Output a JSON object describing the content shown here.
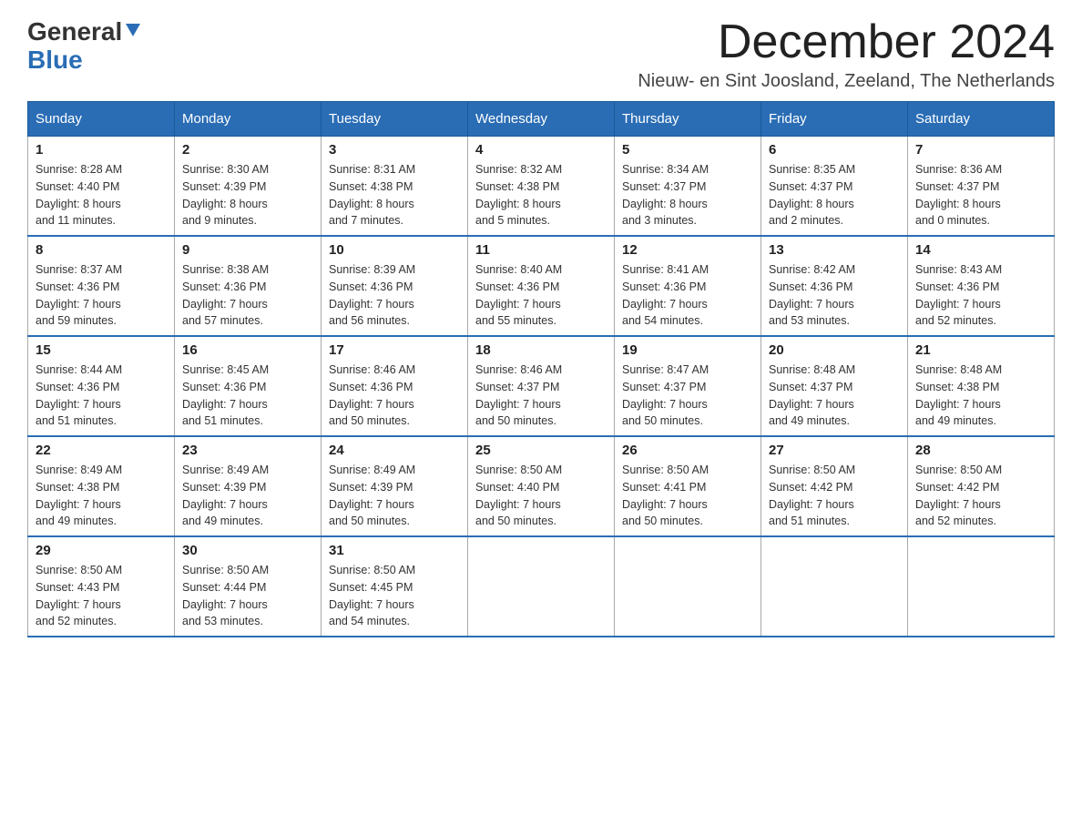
{
  "logo": {
    "text1": "General",
    "text2": "Blue"
  },
  "title": "December 2024",
  "location": "Nieuw- en Sint Joosland, Zeeland, The Netherlands",
  "headers": [
    "Sunday",
    "Monday",
    "Tuesday",
    "Wednesday",
    "Thursday",
    "Friday",
    "Saturday"
  ],
  "weeks": [
    [
      {
        "day": "1",
        "sunrise": "8:28 AM",
        "sunset": "4:40 PM",
        "daylight": "8 hours and 11 minutes."
      },
      {
        "day": "2",
        "sunrise": "8:30 AM",
        "sunset": "4:39 PM",
        "daylight": "8 hours and 9 minutes."
      },
      {
        "day": "3",
        "sunrise": "8:31 AM",
        "sunset": "4:38 PM",
        "daylight": "8 hours and 7 minutes."
      },
      {
        "day": "4",
        "sunrise": "8:32 AM",
        "sunset": "4:38 PM",
        "daylight": "8 hours and 5 minutes."
      },
      {
        "day": "5",
        "sunrise": "8:34 AM",
        "sunset": "4:37 PM",
        "daylight": "8 hours and 3 minutes."
      },
      {
        "day": "6",
        "sunrise": "8:35 AM",
        "sunset": "4:37 PM",
        "daylight": "8 hours and 2 minutes."
      },
      {
        "day": "7",
        "sunrise": "8:36 AM",
        "sunset": "4:37 PM",
        "daylight": "8 hours and 0 minutes."
      }
    ],
    [
      {
        "day": "8",
        "sunrise": "8:37 AM",
        "sunset": "4:36 PM",
        "daylight": "7 hours and 59 minutes."
      },
      {
        "day": "9",
        "sunrise": "8:38 AM",
        "sunset": "4:36 PM",
        "daylight": "7 hours and 57 minutes."
      },
      {
        "day": "10",
        "sunrise": "8:39 AM",
        "sunset": "4:36 PM",
        "daylight": "7 hours and 56 minutes."
      },
      {
        "day": "11",
        "sunrise": "8:40 AM",
        "sunset": "4:36 PM",
        "daylight": "7 hours and 55 minutes."
      },
      {
        "day": "12",
        "sunrise": "8:41 AM",
        "sunset": "4:36 PM",
        "daylight": "7 hours and 54 minutes."
      },
      {
        "day": "13",
        "sunrise": "8:42 AM",
        "sunset": "4:36 PM",
        "daylight": "7 hours and 53 minutes."
      },
      {
        "day": "14",
        "sunrise": "8:43 AM",
        "sunset": "4:36 PM",
        "daylight": "7 hours and 52 minutes."
      }
    ],
    [
      {
        "day": "15",
        "sunrise": "8:44 AM",
        "sunset": "4:36 PM",
        "daylight": "7 hours and 51 minutes."
      },
      {
        "day": "16",
        "sunrise": "8:45 AM",
        "sunset": "4:36 PM",
        "daylight": "7 hours and 51 minutes."
      },
      {
        "day": "17",
        "sunrise": "8:46 AM",
        "sunset": "4:36 PM",
        "daylight": "7 hours and 50 minutes."
      },
      {
        "day": "18",
        "sunrise": "8:46 AM",
        "sunset": "4:37 PM",
        "daylight": "7 hours and 50 minutes."
      },
      {
        "day": "19",
        "sunrise": "8:47 AM",
        "sunset": "4:37 PM",
        "daylight": "7 hours and 50 minutes."
      },
      {
        "day": "20",
        "sunrise": "8:48 AM",
        "sunset": "4:37 PM",
        "daylight": "7 hours and 49 minutes."
      },
      {
        "day": "21",
        "sunrise": "8:48 AM",
        "sunset": "4:38 PM",
        "daylight": "7 hours and 49 minutes."
      }
    ],
    [
      {
        "day": "22",
        "sunrise": "8:49 AM",
        "sunset": "4:38 PM",
        "daylight": "7 hours and 49 minutes."
      },
      {
        "day": "23",
        "sunrise": "8:49 AM",
        "sunset": "4:39 PM",
        "daylight": "7 hours and 49 minutes."
      },
      {
        "day": "24",
        "sunrise": "8:49 AM",
        "sunset": "4:39 PM",
        "daylight": "7 hours and 50 minutes."
      },
      {
        "day": "25",
        "sunrise": "8:50 AM",
        "sunset": "4:40 PM",
        "daylight": "7 hours and 50 minutes."
      },
      {
        "day": "26",
        "sunrise": "8:50 AM",
        "sunset": "4:41 PM",
        "daylight": "7 hours and 50 minutes."
      },
      {
        "day": "27",
        "sunrise": "8:50 AM",
        "sunset": "4:42 PM",
        "daylight": "7 hours and 51 minutes."
      },
      {
        "day": "28",
        "sunrise": "8:50 AM",
        "sunset": "4:42 PM",
        "daylight": "7 hours and 52 minutes."
      }
    ],
    [
      {
        "day": "29",
        "sunrise": "8:50 AM",
        "sunset": "4:43 PM",
        "daylight": "7 hours and 52 minutes."
      },
      {
        "day": "30",
        "sunrise": "8:50 AM",
        "sunset": "4:44 PM",
        "daylight": "7 hours and 53 minutes."
      },
      {
        "day": "31",
        "sunrise": "8:50 AM",
        "sunset": "4:45 PM",
        "daylight": "7 hours and 54 minutes."
      },
      null,
      null,
      null,
      null
    ]
  ],
  "cell_labels": {
    "sunrise": "Sunrise: ",
    "sunset": "Sunset: ",
    "daylight": "Daylight: "
  }
}
